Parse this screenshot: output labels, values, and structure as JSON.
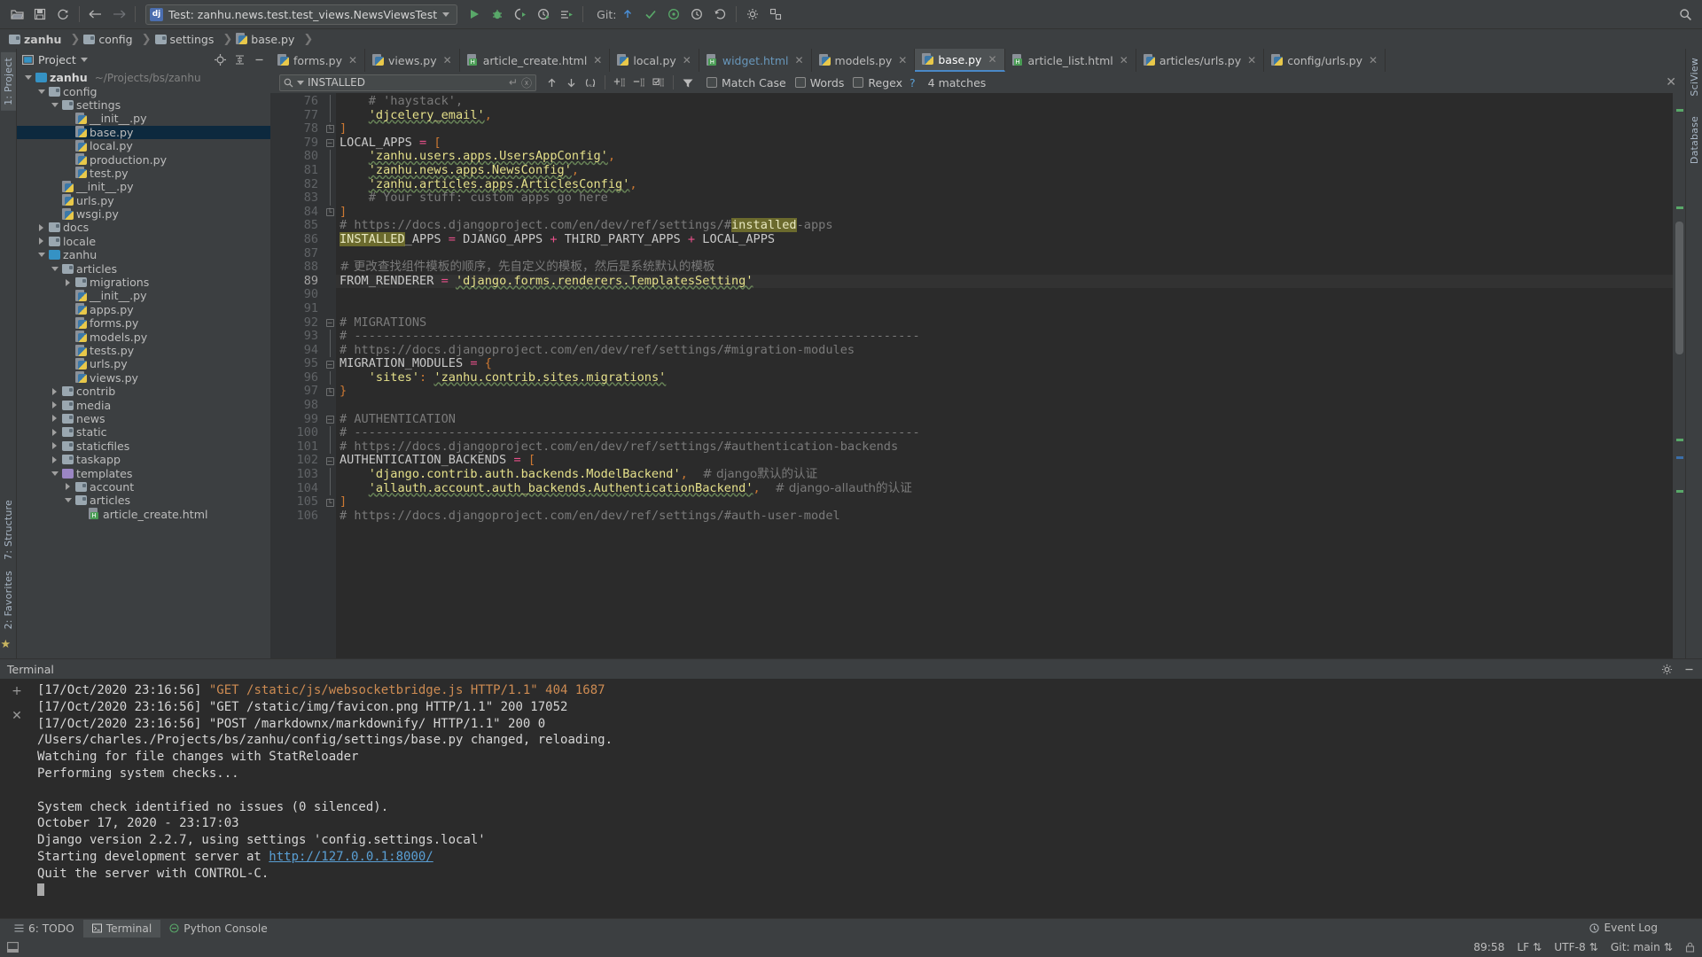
{
  "toolbar": {
    "buttons": [
      {
        "name": "open-folder",
        "glyph": "folder-open-icon"
      },
      {
        "name": "save-all",
        "glyph": "save-icon"
      },
      {
        "name": "sync",
        "glyph": "refresh-icon"
      },
      {
        "name": "back",
        "glyph": "arrow-left-icon"
      },
      {
        "name": "forward",
        "glyph": "arrow-right-icon"
      }
    ],
    "run_configuration": "Test: zanhu.news.test.test_views.NewsViewsTest",
    "run_config_badge": "dj",
    "run_buttons": [
      "run-icon",
      "debug-icon",
      "run-coverage-icon",
      "profile-icon",
      "run-with-options-icon"
    ],
    "git_label": "Git:",
    "git_buttons": [
      "update-project-icon",
      "commit-icon",
      "push-icon",
      "history-icon",
      "rollback-icon"
    ],
    "right_buttons": [
      "settings-gear-icon",
      "project-structure-icon",
      "search-everywhere-icon"
    ]
  },
  "breadcrumb": {
    "items": [
      {
        "label": "zanhu",
        "icon": "folder-icon"
      },
      {
        "label": "config",
        "icon": "folder-icon"
      },
      {
        "label": "settings",
        "icon": "folder-icon"
      },
      {
        "label": "base.py",
        "icon": "python-file-icon"
      }
    ]
  },
  "left_tool_strip": {
    "tabs": [
      "1: Project",
      "7: Structure",
      "2: Favorites"
    ]
  },
  "right_tool_strip": {
    "tabs": [
      "SciView",
      "Database"
    ]
  },
  "project_panel": {
    "title": "Project",
    "header_icons": [
      "target-icon",
      "collapse-all-icon",
      "minimize-icon"
    ],
    "tree": [
      {
        "depth": 0,
        "twisty": "down",
        "icon": "folder-blue",
        "label": "zanhu",
        "bold": true,
        "path": "~/Projects/bs/zanhu"
      },
      {
        "depth": 1,
        "twisty": "down",
        "icon": "folder",
        "label": "config"
      },
      {
        "depth": 2,
        "twisty": "down",
        "icon": "folder",
        "label": "settings"
      },
      {
        "depth": 3,
        "twisty": "none",
        "icon": "python",
        "label": "__init__.py"
      },
      {
        "depth": 3,
        "twisty": "none",
        "icon": "python",
        "label": "base.py",
        "selected": true
      },
      {
        "depth": 3,
        "twisty": "none",
        "icon": "python",
        "label": "local.py"
      },
      {
        "depth": 3,
        "twisty": "none",
        "icon": "python",
        "label": "production.py"
      },
      {
        "depth": 3,
        "twisty": "none",
        "icon": "python",
        "label": "test.py"
      },
      {
        "depth": 2,
        "twisty": "none",
        "icon": "python",
        "label": "__init__.py"
      },
      {
        "depth": 2,
        "twisty": "none",
        "icon": "python",
        "label": "urls.py"
      },
      {
        "depth": 2,
        "twisty": "none",
        "icon": "python",
        "label": "wsgi.py"
      },
      {
        "depth": 1,
        "twisty": "right",
        "icon": "folder",
        "label": "docs"
      },
      {
        "depth": 1,
        "twisty": "right",
        "icon": "folder",
        "label": "locale"
      },
      {
        "depth": 1,
        "twisty": "down",
        "icon": "folder-blue",
        "label": "zanhu"
      },
      {
        "depth": 2,
        "twisty": "down",
        "icon": "folder",
        "label": "articles"
      },
      {
        "depth": 3,
        "twisty": "right",
        "icon": "folder",
        "label": "migrations"
      },
      {
        "depth": 3,
        "twisty": "none",
        "icon": "python",
        "label": "__init__.py"
      },
      {
        "depth": 3,
        "twisty": "none",
        "icon": "python",
        "label": "apps.py"
      },
      {
        "depth": 3,
        "twisty": "none",
        "icon": "python",
        "label": "forms.py"
      },
      {
        "depth": 3,
        "twisty": "none",
        "icon": "python",
        "label": "models.py"
      },
      {
        "depth": 3,
        "twisty": "none",
        "icon": "python",
        "label": "tests.py"
      },
      {
        "depth": 3,
        "twisty": "none",
        "icon": "python",
        "label": "urls.py"
      },
      {
        "depth": 3,
        "twisty": "none",
        "icon": "python",
        "label": "views.py"
      },
      {
        "depth": 2,
        "twisty": "right",
        "icon": "folder",
        "label": "contrib"
      },
      {
        "depth": 2,
        "twisty": "right",
        "icon": "folder",
        "label": "media"
      },
      {
        "depth": 2,
        "twisty": "right",
        "icon": "folder",
        "label": "news"
      },
      {
        "depth": 2,
        "twisty": "right",
        "icon": "folder",
        "label": "static"
      },
      {
        "depth": 2,
        "twisty": "right",
        "icon": "folder",
        "label": "staticfiles"
      },
      {
        "depth": 2,
        "twisty": "right",
        "icon": "folder",
        "label": "taskapp"
      },
      {
        "depth": 2,
        "twisty": "down",
        "icon": "folder-purple",
        "label": "templates"
      },
      {
        "depth": 3,
        "twisty": "right",
        "icon": "folder",
        "label": "account"
      },
      {
        "depth": 3,
        "twisty": "down",
        "icon": "folder",
        "label": "articles"
      },
      {
        "depth": 4,
        "twisty": "none",
        "icon": "html",
        "label": "article_create.html"
      }
    ]
  },
  "editor_tabs": [
    {
      "label": "forms.py",
      "icon": "python-file-icon",
      "active": false
    },
    {
      "label": "views.py",
      "icon": "python-file-icon",
      "active": false
    },
    {
      "label": "article_create.html",
      "icon": "html-file-icon",
      "active": false
    },
    {
      "label": "local.py",
      "icon": "python-file-icon",
      "active": false
    },
    {
      "label": "widget.html",
      "icon": "html-file-icon",
      "active": false,
      "modified": true
    },
    {
      "label": "models.py",
      "icon": "python-file-icon",
      "active": false
    },
    {
      "label": "base.py",
      "icon": "python-file-icon",
      "active": true
    },
    {
      "label": "article_list.html",
      "icon": "html-file-icon",
      "active": false
    },
    {
      "label": "articles/urls.py",
      "icon": "python-file-icon",
      "active": false
    },
    {
      "label": "config/urls.py",
      "icon": "python-file-icon",
      "active": false
    }
  ],
  "find_bar": {
    "query": "INSTALLED",
    "placeholder": "Search",
    "buttons": [
      "find-previous-icon",
      "find-next-icon",
      "select-all-occurrences-icon",
      "add-line-icon",
      "remove-line-icon",
      "select-all-icon",
      "filter-icon"
    ],
    "options": [
      {
        "label": "Match Case",
        "checked": false
      },
      {
        "label": "Words",
        "checked": false
      },
      {
        "label": "Regex",
        "checked": false
      }
    ],
    "help_glyph": "?",
    "match_count": "4 matches",
    "close": "close-icon"
  },
  "code": {
    "first_line": 76,
    "current_line": 89,
    "lines": [
      {
        "n": 76,
        "fold": "pipe",
        "html": "<span class=\"cmt\">    # 'haystack',</span>"
      },
      {
        "n": 77,
        "fold": "pipe",
        "html": "    <span class=\"str wavy\">'djcelery_email'</span><span class=\"punc\">,</span>"
      },
      {
        "n": 78,
        "fold": "end",
        "html": "<span class=\"punc\">]</span>"
      },
      {
        "n": 79,
        "fold": "start",
        "html": "<span class=\"var\">LOCAL_APPS</span> <span class=\"op\">=</span> <span class=\"punc\">[</span>"
      },
      {
        "n": 80,
        "fold": "pipe",
        "html": "    <span class=\"str wavy\">'zanhu.users.apps.UsersAppConfig'</span><span class=\"punc\">,</span>"
      },
      {
        "n": 81,
        "fold": "pipe",
        "html": "    <span class=\"str wavy\">'zanhu.news.apps.NewsConfig'</span><span class=\"punc\">,</span>"
      },
      {
        "n": 82,
        "fold": "pipe",
        "html": "    <span class=\"str wavy\">'zanhu.articles.apps.ArticlesConfig'</span><span class=\"punc\">,</span>"
      },
      {
        "n": 83,
        "fold": "pipe",
        "html": "<span class=\"cmt\">    # Your stuff: custom apps go here</span>"
      },
      {
        "n": 84,
        "fold": "end",
        "html": "<span class=\"punc\">]</span>"
      },
      {
        "n": 85,
        "fold": "none",
        "html": "<span class=\"cmt\"># https://docs.djangoproject.com/en/dev/ref/settings/#</span><span class=\"hl\">installed</span><span class=\"cmt\">-apps</span>"
      },
      {
        "n": 86,
        "fold": "none",
        "html": "<span class=\"hl\">INSTALLED</span><span class=\"var\">_APPS</span> <span class=\"op\">=</span> <span class=\"var\">DJANGO_APPS</span> <span class=\"op\">+</span> <span class=\"var\">THIRD_PARTY_APPS</span> <span class=\"op\">+</span> <span class=\"var\">LOCAL_APPS</span>"
      },
      {
        "n": 87,
        "fold": "none",
        "html": ""
      },
      {
        "n": 88,
        "fold": "none",
        "html": "<span class=\"cmt cjk\"># 更改查找组件模板的顺序，先自定义的模板，然后是系统默认的模板</span>"
      },
      {
        "n": 89,
        "fold": "none",
        "current": true,
        "html": "<span class=\"var\">FROM_RENDERER</span> <span class=\"op\">=</span> <span class=\"str wavy\">'django.forms.renderers.TemplatesSetting'</span>"
      },
      {
        "n": 90,
        "fold": "none",
        "html": ""
      },
      {
        "n": 91,
        "fold": "none",
        "html": ""
      },
      {
        "n": 92,
        "fold": "start",
        "html": "<span class=\"cmt\"># MIGRATIONS</span>"
      },
      {
        "n": 93,
        "fold": "pipe",
        "html": "<span class=\"cmt\"># ------------------------------------------------------------------------------</span>"
      },
      {
        "n": 94,
        "fold": "pipe",
        "html": "<span class=\"cmt\"># https://docs.djangoproject.com/en/dev/ref/settings/#migration-modules</span>"
      },
      {
        "n": 95,
        "fold": "start",
        "html": "<span class=\"var\">MIGRATION_MODULES</span> <span class=\"op\">=</span> <span class=\"punc\">{</span>"
      },
      {
        "n": 96,
        "fold": "pipe",
        "html": "    <span class=\"str\">'sites'</span><span class=\"punc\">:</span> <span class=\"str wavy\">'zanhu.contrib.sites.migrations'</span>"
      },
      {
        "n": 97,
        "fold": "end",
        "html": "<span class=\"punc\">}</span>"
      },
      {
        "n": 98,
        "fold": "none",
        "html": ""
      },
      {
        "n": 99,
        "fold": "start",
        "html": "<span class=\"cmt\"># AUTHENTICATION</span>"
      },
      {
        "n": 100,
        "fold": "pipe",
        "html": "<span class=\"cmt\"># ------------------------------------------------------------------------------</span>"
      },
      {
        "n": 101,
        "fold": "pipe",
        "html": "<span class=\"cmt\"># https://docs.djangoproject.com/en/dev/ref/settings/#authentication-backends</span>"
      },
      {
        "n": 102,
        "fold": "start",
        "html": "<span class=\"var\">AUTHENTICATION_BACKENDS</span> <span class=\"op\">=</span> <span class=\"punc\">[</span>"
      },
      {
        "n": 103,
        "fold": "pipe",
        "html": "    <span class=\"str\">'django.contrib.auth.backends.ModelBackend'</span><span class=\"punc\">,</span>  <span class=\"cmt cjk\"># django默认的认证</span>"
      },
      {
        "n": 104,
        "fold": "pipe",
        "html": "    <span class=\"str wavy\">'allauth.account.auth_backends.AuthenticationBackend'</span><span class=\"punc\">,</span>  <span class=\"cmt cjk\"># django-allauth的认证</span>"
      },
      {
        "n": 105,
        "fold": "end",
        "html": "<span class=\"punc\">]</span>"
      },
      {
        "n": 106,
        "fold": "none",
        "html": "<span class=\"cmt\"># https://docs.djangoproject.com/en/dev/ref/settings/#auth-user-model</span>"
      }
    ]
  },
  "terminal": {
    "title": "Terminal",
    "head_icons": [
      "gear-icon",
      "minimize-icon"
    ],
    "side_buttons": [
      "new-session-icon",
      "close-session-icon"
    ],
    "lines": [
      [
        {
          "t": "[17/Oct/2020 23:16:56] ",
          "c": "plain"
        },
        {
          "t": "\"GET /static/js/websocketbridge.js HTTP/1.1\" 404 1687",
          "c": "orange"
        }
      ],
      [
        {
          "t": "[17/Oct/2020 23:16:56] \"GET /static/img/favicon.png HTTP/1.1\" 200 17052",
          "c": "plain"
        }
      ],
      [
        {
          "t": "[17/Oct/2020 23:16:56] \"POST /markdownx/markdownify/ HTTP/1.1\" 200 0",
          "c": "plain"
        }
      ],
      [
        {
          "t": "/Users/charles./Projects/bs/zanhu/config/settings/base.py changed, reloading.",
          "c": "plain"
        }
      ],
      [
        {
          "t": "Watching for file changes with StatReloader",
          "c": "plain"
        }
      ],
      [
        {
          "t": "Performing system checks...",
          "c": "plain"
        }
      ],
      [
        {
          "t": "",
          "c": "plain"
        }
      ],
      [
        {
          "t": "System check identified no issues (0 silenced).",
          "c": "plain"
        }
      ],
      [
        {
          "t": "October 17, 2020 - 23:17:03",
          "c": "plain"
        }
      ],
      [
        {
          "t": "Django version 2.2.7, using settings 'config.settings.local'",
          "c": "plain"
        }
      ],
      [
        {
          "t": "Starting development server at ",
          "c": "plain"
        },
        {
          "t": "http://127.0.0.1:8000/",
          "c": "link"
        }
      ],
      [
        {
          "t": "Quit the server with CONTROL-C.",
          "c": "plain"
        }
      ]
    ]
  },
  "bottom_bar": {
    "items": [
      {
        "label": "6: TODO",
        "icon": "todo-icon",
        "active": false
      },
      {
        "label": "Terminal",
        "icon": "terminal-icon",
        "active": true
      },
      {
        "label": "Python Console",
        "icon": "python-console-icon",
        "active": false
      }
    ]
  },
  "status_bar": {
    "caret": "89:58",
    "line_sep": "LF",
    "encoding": "UTF-8",
    "git_branch": "Git: main",
    "event_log": "Event Log",
    "lock_icon": "lock-icon"
  },
  "colors": {
    "panel_bg": "#3c3f41",
    "editor_bg": "#2b2b2b",
    "gutter_bg": "#313335",
    "selection_blue": "#0d293e",
    "tab_active": "#4e5254",
    "accent_blue": "#4a88c7",
    "string_yellow": "#e5e08a",
    "keyword_orange": "#cc7832",
    "comment_gray": "#7a7a7a",
    "highlight_olive": "#6b6a2d",
    "link_blue": "#5a9fd4",
    "terminal_orange": "#cd8b52"
  }
}
